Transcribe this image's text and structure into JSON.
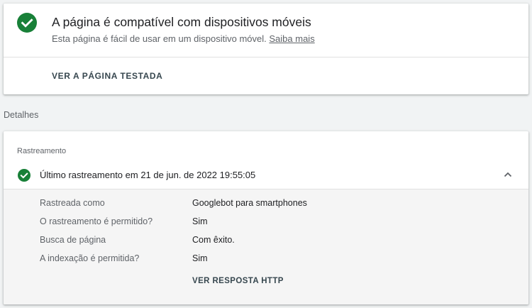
{
  "result": {
    "title": "A página é compatível com dispositivos móveis",
    "subtitle": "Esta página é fácil de usar em um dispositivo móvel.",
    "learn_more": "Saiba mais",
    "view_tested_page": "VER A PÁGINA TESTADA",
    "status_color": "#188038",
    "status_icon": "check-circle-icon"
  },
  "details": {
    "label": "Detalhes",
    "section_label": "Rastreamento",
    "last_crawl": "Último rastreamento em 21 de jun. de 2022 19:55:05",
    "expand_icon": "chevron-up-icon",
    "rows": [
      {
        "key": "Rastreada como",
        "value": "Googlebot para smartphones"
      },
      {
        "key": "O rastreamento é permitido?",
        "value": "Sim"
      },
      {
        "key": "Busca de página",
        "value": "Com êxito."
      },
      {
        "key": "A indexação é permitida?",
        "value": "Sim"
      }
    ],
    "http_response_button": "VER RESPOSTA HTTP"
  }
}
